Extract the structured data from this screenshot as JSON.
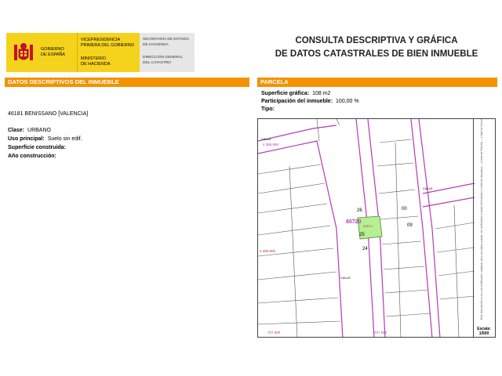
{
  "header": {
    "gobierno": [
      "GOBIERNO",
      "DE ESPAÑA"
    ],
    "vicepresidencia": [
      "VICEPRESIDENCIA",
      "PRIMERA DEL GOBIERNO",
      "MINISTERIO",
      "DE HACIENDA"
    ],
    "secretaria": [
      "SECRETARÍA DE ESTADO",
      "DE HACIENDA",
      "DIRECCIÓN GENERAL",
      "DEL CATASTRO"
    ]
  },
  "title": [
    "CONSULTA DESCRIPTIVA Y GRÁFICA",
    "DE DATOS CATASTRALES DE BIEN INMUEBLE"
  ],
  "sections": {
    "left": "DATOS DESCRIPTIVOS DEL INMUEBLE",
    "right": "PARCELA"
  },
  "inmueble": {
    "address": "46181 BENISSANO [VALENCIA]",
    "clase_label": "Clase:",
    "clase_value": "URBANO",
    "uso_label": "Uso principal:",
    "uso_value": "Suelo sin edif.",
    "superficie_label": "Superficie construida:",
    "anio_label": "Año construcción:"
  },
  "parcela": {
    "sup_label": "Superficie gráfica:",
    "sup_value": "108 m2",
    "part_label": "Participación del inmueble:",
    "part_value": "100,00 %",
    "tipo_label": "Tipo:"
  },
  "map": {
    "numbers": [
      "26",
      "25",
      "24",
      "00",
      "09"
    ],
    "parcel_code": "60720",
    "parcel_tag": "SUELO",
    "coord_top_left": "4.385.850",
    "coord_mid_left": "4.385.800",
    "coord_bottom_left": "707.900",
    "coord_bottom_mid": "707.950",
    "street_labels": [
      "CALLE",
      "CALLE",
      "CALLE"
    ],
    "legend": "Este documento no es una certificación catastral, pero sus datos pueden ser verificados a través del Catastro. Límite de Manzana — Límite de Parcela — Límite de Construcciones — Mobiliario y aceras — Límite zona verde — Hidrografía",
    "scale_label": "Escala:",
    "scale_value": "1/500"
  },
  "colors": {
    "orange": "#f39200",
    "yellow": "#f5d21c",
    "parcel_fill": "#b7ef95",
    "block_line": "#b23cb5"
  }
}
